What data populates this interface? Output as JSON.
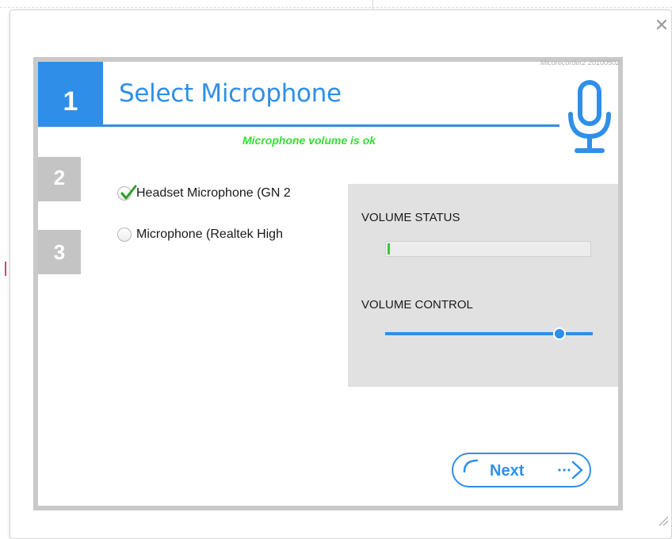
{
  "window": {
    "close_glyph": "✕",
    "version_text": "Micorecorder2 20100502"
  },
  "steps": [
    {
      "number": "1",
      "active": true
    },
    {
      "number": "2",
      "active": false
    },
    {
      "number": "3",
      "active": false
    }
  ],
  "header": {
    "title": "Select Microphone",
    "status_message": "Microphone volume is ok",
    "icon": "microphone-icon"
  },
  "microphones": [
    {
      "label": "Headset Microphone (GN 2",
      "selected": true
    },
    {
      "label": "Microphone (Realtek High",
      "selected": false
    }
  ],
  "volume": {
    "status_label": "VOLUME STATUS",
    "status_level_fraction": 0.01,
    "control_label": "VOLUME CONTROL",
    "control_level_fraction": 0.84
  },
  "footer": {
    "next_label": "Next"
  },
  "colors": {
    "accent": "#2f8fe8",
    "status_ok": "#33dd33",
    "inactive_step": "#c4c4c4",
    "panel_bg": "#e1e1e1"
  }
}
